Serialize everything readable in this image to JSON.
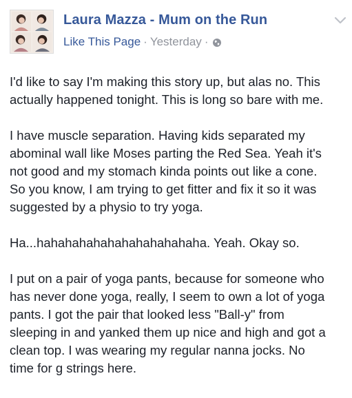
{
  "post": {
    "author": "Laura Mazza - Mum on the Run",
    "like_page": "Like This Page",
    "separator": "·",
    "timestamp": "Yesterday",
    "privacy_icon": "globe-icon",
    "menu_icon": "chevron-down-icon",
    "paragraphs": [
      "I'd like to say I'm making this story up, but alas no. This\nactually happened tonight. This is long so bare with me.",
      "I have muscle separation. Having kids separated my\nabominal wall like Moses parting the Red Sea. Yeah it's\nnot good and my stomach kinda points out like a cone.\nSo you know, I am trying to get fitter and fix it so it was\nsuggested by a physio to try yoga.",
      "Ha...hahahahahahahahahahahaha. Yeah. Okay so.",
      "I put on a pair of yoga pants, because for someone who\nhas never done yoga, really, I seem to own a lot of yoga\npants. I got the pair that looked less \"Ball-y\" from\nsleeping in and yanked them up nice and high and got a\nclean top. I was wearing my regular nanna jocks. No\ntime for g strings here."
    ]
  },
  "colors": {
    "link": "#365899",
    "meta": "#90949c",
    "text": "#1d2129"
  }
}
